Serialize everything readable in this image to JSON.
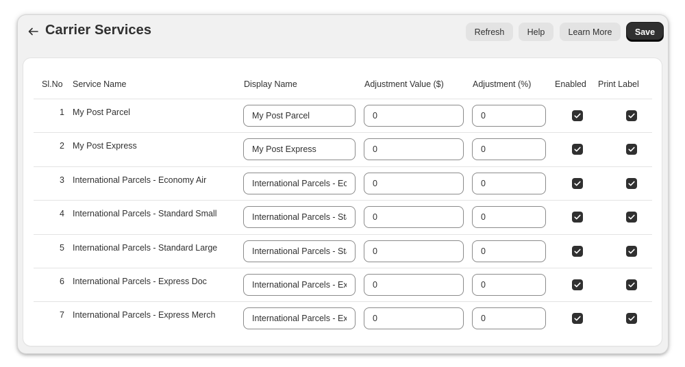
{
  "header": {
    "title": "Carrier Services",
    "buttons": {
      "refresh": "Refresh",
      "help": "Help",
      "learn_more": "Learn More",
      "save": "Save"
    }
  },
  "table": {
    "columns": {
      "sl_no": "Sl.No",
      "service_name": "Service Name",
      "display_name": "Display Name",
      "adjustment_value": "Adjustment Value ($)",
      "adjustment_percent": "Adjustment (%)",
      "enabled": "Enabled",
      "print_label": "Print Label"
    },
    "rows": [
      {
        "sl_no": "1",
        "service_name": "My Post Parcel",
        "display_name": "My Post Parcel",
        "adjustment_value": "0",
        "adjustment_percent": "0",
        "enabled": true,
        "print_label": true
      },
      {
        "sl_no": "2",
        "service_name": "My Post Express",
        "display_name": "My Post Express",
        "adjustment_value": "0",
        "adjustment_percent": "0",
        "enabled": true,
        "print_label": true
      },
      {
        "sl_no": "3",
        "service_name": "International Parcels - Economy Air",
        "display_name": "International Parcels - Economy Air",
        "adjustment_value": "0",
        "adjustment_percent": "0",
        "enabled": true,
        "print_label": true
      },
      {
        "sl_no": "4",
        "service_name": "International Parcels - Standard Small",
        "display_name": "International Parcels - Standard Small",
        "adjustment_value": "0",
        "adjustment_percent": "0",
        "enabled": true,
        "print_label": true
      },
      {
        "sl_no": "5",
        "service_name": "International Parcels - Standard Large",
        "display_name": "International Parcels - Standard Large",
        "adjustment_value": "0",
        "adjustment_percent": "0",
        "enabled": true,
        "print_label": true
      },
      {
        "sl_no": "6",
        "service_name": "International Parcels - Express Doc",
        "display_name": "International Parcels - Express Doc",
        "adjustment_value": "0",
        "adjustment_percent": "0",
        "enabled": true,
        "print_label": true
      },
      {
        "sl_no": "7",
        "service_name": "International Parcels - Express Merch",
        "display_name": "International Parcels - Express Merch",
        "adjustment_value": "0",
        "adjustment_percent": "0",
        "enabled": true,
        "print_label": true
      }
    ]
  },
  "icons": {
    "back": "arrow-left-icon",
    "checked": "checkmark-icon"
  },
  "colors": {
    "primary_button": "#303030",
    "secondary_button": "#e3e3e3",
    "checkbox_fill": "#303030",
    "background": "#f1f1f1",
    "card": "#ffffff"
  }
}
